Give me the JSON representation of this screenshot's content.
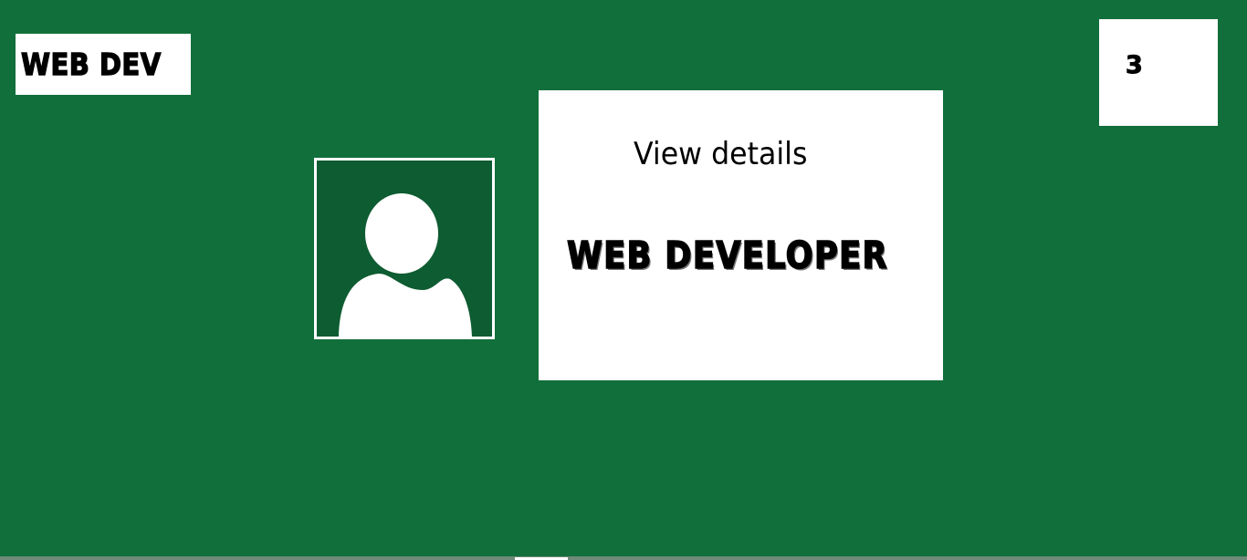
{
  "header": {
    "logo_text": "WEB DEV",
    "count": "3"
  },
  "profile": {
    "avatar_icon": "default-user-icon",
    "view_details_label": "View details",
    "role_title": "WEB DEVELOPER"
  },
  "colors": {
    "background": "#116f3b",
    "avatar_background": "#0e5c31",
    "panel": "#ffffff",
    "text": "#000000"
  }
}
